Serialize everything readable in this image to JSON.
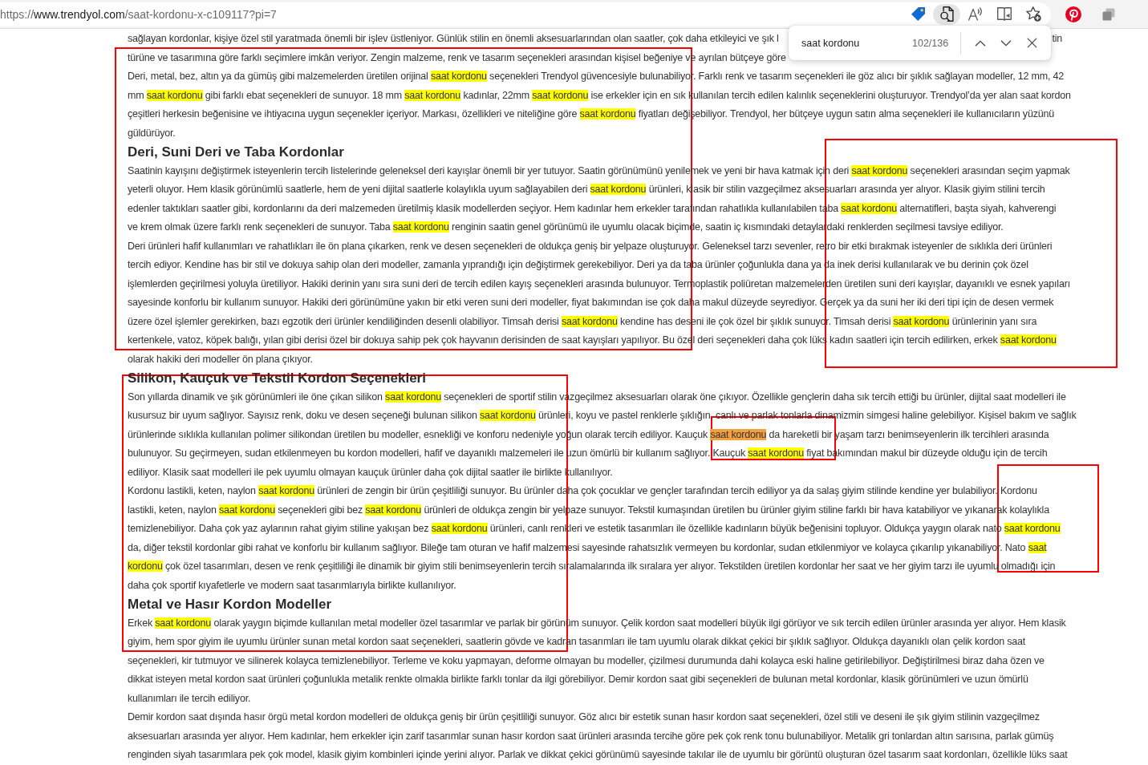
{
  "address_bar": {
    "scheme": "https://",
    "host": "www.trendyol.com",
    "path": "/saat-kordonu-x-c109117?pi=7"
  },
  "toolbar": {
    "find_button_active": true
  },
  "find_bar": {
    "query": "saat kordonu",
    "count": "102/136"
  },
  "article": {
    "sections": [
      {
        "paragraphs": [
          {
            "lines": [
              [
                {
                  "kind": "text",
                  "text": "sağlayan kordonlar, kişiye özel stil yaratmada önemli bir işlev üstleniyor. Günlük stilin en önemli aksesuarlarından olan saatler, çok daha etkileyici ve şık l"
                },
                {
                  "kind": "right-fragment",
                  "text": "tin"
                }
              ],
              [
                {
                  "kind": "text",
                  "text": "türüne ve tasarımına göre farklı seçimlere imkân veriyor. Zengin malzeme, renk ve tasarım seçenekleri arasından kişisel beğeniye ve ayrılan bütçeye göre"
                }
              ]
            ]
          },
          {
            "lines": [
              [
                {
                  "kind": "text",
                  "text": "Deri, metal, bez, altın ya da gümüş gibi malzemelerden üretilen orijinal "
                },
                {
                  "kind": "match",
                  "text": "saat kordonu"
                },
                {
                  "kind": "text",
                  "text": " seçenekleri Trendyol güvencesiyle bulunabiliyor. Farklı renk ve tasarım seçenekleri ile göz alıcı bir şıklık sağlayan modeller, 12 mm, 42"
                }
              ],
              [
                {
                  "kind": "text",
                  "text": "mm "
                },
                {
                  "kind": "match",
                  "text": "saat kordonu"
                },
                {
                  "kind": "text",
                  "text": " gibi farklı ebat seçenekleri de sunuyor. 18 mm "
                },
                {
                  "kind": "match",
                  "text": "saat kordonu"
                },
                {
                  "kind": "text",
                  "text": " kadınlar, 22mm "
                },
                {
                  "kind": "match",
                  "text": "saat kordonu"
                },
                {
                  "kind": "text",
                  "text": " ise erkekler için en sık kullanılan tercih edilen kalınlık seçeneklerini oluşturuyor. Trendyol’da yer alan saat kordon"
                }
              ],
              [
                {
                  "kind": "text",
                  "text": "çeşitleri herkesin beğenisine ve ihtiyacına uygun seçenekler içeriyor. Markası, özellikleri ve niteliğine göre "
                },
                {
                  "kind": "match",
                  "text": "saat kordonu"
                },
                {
                  "kind": "text",
                  "text": " fiyatları değişebiliyor. Trendyol, her bütçeye uygun satın alma seçenekleri ile kullanıcıların yüzünü"
                }
              ],
              [
                {
                  "kind": "text",
                  "text": "güldürüyor."
                }
              ]
            ]
          }
        ]
      },
      {
        "heading": "Deri, Suni Deri ve Taba Kordonlar",
        "paragraphs": [
          {
            "lines": [
              [
                {
                  "kind": "text",
                  "text": "Saatinin kayışını değiştirmek isteyenlerin tercih listelerinde geleneksel deri kayışlar önemli bir yer tutuyor. Saatin görünümünü yenilemek ve yeni bir hava katmak için deri "
                },
                {
                  "kind": "match",
                  "text": "saat kordonu"
                },
                {
                  "kind": "text",
                  "text": " seçenekleri arasından seçim yapmak"
                }
              ],
              [
                {
                  "kind": "text",
                  "text": "yeterli oluyor. Hem klasik görünümlü saatlerle, hem de yeni dijital saatlerle kolaylıkla uyum sağlayabilen deri "
                },
                {
                  "kind": "match",
                  "text": "saat kordonu"
                },
                {
                  "kind": "text",
                  "text": " ürünleri, klasik bir stilin vazgeçilmez aksesuarları arasında yer alıyor. Klasik giyim stilini tercih"
                }
              ],
              [
                {
                  "kind": "text",
                  "text": "edenler taktıkları saatler gibi, kordonlarını da deri malzemeden üretilmiş klasik modellerden seçiyor. Hem kadınlar hem erkekler tarafından rahatlıkla kullanılabilen taba "
                },
                {
                  "kind": "match",
                  "text": "saat kordonu"
                },
                {
                  "kind": "text",
                  "text": " alternatifleri, başta siyah, kahverengi"
                }
              ],
              [
                {
                  "kind": "text",
                  "text": "ve krem olmak üzere farklı renk seçenekleri de sunuyor. Taba "
                },
                {
                  "kind": "match",
                  "text": "saat kordonu"
                },
                {
                  "kind": "text",
                  "text": " renginin saatin genel görünümü ile uyumlu olacak biçimde, saatin iç kısmındaki detaylardaki renklerden seçilmesi tavsiye ediliyor."
                }
              ]
            ]
          },
          {
            "lines": [
              [
                {
                  "kind": "text",
                  "text": "Deri ürünleri hafif kullanımları ve rahatlıkları ile ön plana çıkarken, renk ve desen seçenekleri de oldukça geniş bir yelpaze oluşturuyor. Geleneksel tarzı sevenler, retro bir etki bırakmak isteyenler de sıklıkla deri ürünleri"
                }
              ],
              [
                {
                  "kind": "text",
                  "text": "tercih ediyor. Kendine has bir stil ve dokuya sahip olan deri modeller, zamanla yıprandığı için değiştirmek gerekebiliyor. Deri ya da taba ürünler çoğunlukla dana ya da inek derisi kullanılarak ve bu derinin çok özel"
                }
              ],
              [
                {
                  "kind": "text",
                  "text": "işlemlerden geçirilmesi yoluyla üretiliyor. Hakiki derinin yanı sıra suni deri de tercih edilen kayış seçenekleri arasında bulunuyor. Termoplastik poliüretan malzemelerden üretilen suni deri kayışlar, dayanıklı ve esnek yapıları"
                }
              ],
              [
                {
                  "kind": "text",
                  "text": "sayesinde konforlu bir kullanım sunuyor. Hakiki deri görünümüne yakın bir etki veren suni deri modeller, fiyat bakımından ise çok daha makul düzeyde seyrediyor. Gerçek ya da suni her iki deri tipi için de desen vermek"
                }
              ],
              [
                {
                  "kind": "text",
                  "text": "üzere özel işlemler gerekirken, bazı egzotik deri ürünler kendiliğinden desenli olabiliyor. Timsah derisi "
                },
                {
                  "kind": "match",
                  "text": "saat kordonu"
                },
                {
                  "kind": "text",
                  "text": " kendine has deseni ile çok özel bir şıklık sunuyor. Timsah derisi "
                },
                {
                  "kind": "match",
                  "text": "saat kordonu"
                },
                {
                  "kind": "text",
                  "text": " ürünlerinin yanı sıra"
                }
              ],
              [
                {
                  "kind": "text",
                  "text": "kertenkele, vatoz, köpek balığı, yılan gibi derisi özel bir dokuya sahip pek çok hayvanın derisinden de saat kayışları yapılıyor. Bu özel deri seçenekleri daha çok lüks kadın saatleri için tercih edilirken, erkek "
                },
                {
                  "kind": "match",
                  "text": "saat kordonu"
                }
              ],
              [
                {
                  "kind": "text",
                  "text": "olarak hakiki deri modeller ön plana çıkıyor."
                }
              ]
            ]
          }
        ]
      },
      {
        "heading": "Silikon, Kauçuk ve Tekstil Kordon Seçenekleri",
        "paragraphs": [
          {
            "lines": [
              [
                {
                  "kind": "text",
                  "text": "Son yıllarda dinamik ve şık görünümleri ile öne çıkan silikon "
                },
                {
                  "kind": "match",
                  "text": "saat kordonu"
                },
                {
                  "kind": "text",
                  "text": " seçenekleri de sportif stilin vazgeçilmez aksesuarları olarak öne çıkıyor. Özellikle gençlerin daha sık tercih ettiği bu ürünler, dijital saat modelleri ile"
                }
              ],
              [
                {
                  "kind": "text",
                  "text": "kusursuz bir uyum sağlıyor. Sayısız renk, doku ve desen seçeneği bulunan silikon "
                },
                {
                  "kind": "match",
                  "text": "saat kordonu"
                },
                {
                  "kind": "text",
                  "text": " ürünleri, koyu ve pastel renklerle şıklığın, canlı ve parlak tonlarla dinamizmin simgesi haline gelebiliyor. Kişisel bakım ve sağlık"
                }
              ],
              [
                {
                  "kind": "text",
                  "text": "ürünlerinde sıklıkla kullanılan polimer silikondan üretilen bu modeller, esnekliği ve konforu nedeniyle yoğun olarak tercih ediliyor. Kauçuk "
                },
                {
                  "kind": "current-match",
                  "text": "saat kordonu"
                },
                {
                  "kind": "text",
                  "text": " da hareketli bir yaşam tarzı benimseyenlerin ilk tercihleri arasında"
                }
              ],
              [
                {
                  "kind": "text",
                  "text": "bulunuyor. Su geçirmeyen, sudan etkilenmeyen bu kordon modelleri, hafif ve dayanıklı malzemeleri ile uzun ömürlü bir kullanım sağlıyor. Kauçuk "
                },
                {
                  "kind": "match",
                  "text": "saat kordonu"
                },
                {
                  "kind": "text",
                  "text": " fiyat bakımından makul bir düzeyde olduğu için de tercih"
                }
              ],
              [
                {
                  "kind": "text",
                  "text": "ediliyor. Klasik saat modelleri ile pek uyumlu olmayan kauçuk ürünler daha çok dijital saatler ile birlikte kullanılıyor."
                }
              ]
            ]
          },
          {
            "lines": [
              [
                {
                  "kind": "text",
                  "text": "Kordonu lastikli, keten, naylon "
                },
                {
                  "kind": "match",
                  "text": "saat kordonu"
                },
                {
                  "kind": "text",
                  "text": " ürünleri de zengin bir ürün çeşitliliği sunuyor. Bu ürünler daha çok çocuklar ve gençler tarafından tercih ediliyor ya da salaş giyim stilinde kendine yer bulabiliyor. Kordonu"
                }
              ],
              [
                {
                  "kind": "text",
                  "text": "lastikli, keten, naylon "
                },
                {
                  "kind": "match",
                  "text": "saat kordonu"
                },
                {
                  "kind": "text",
                  "text": " seçenekleri gibi bez "
                },
                {
                  "kind": "match",
                  "text": "saat kordonu"
                },
                {
                  "kind": "text",
                  "text": " ürünleri de oldukça zengin bir yelpaze sunuyor. Tekstil kumaşından üretilen bu ürünler giyim stiline farklı bir hava katabiliyor ve yıkanarak kolaylıkla"
                }
              ],
              [
                {
                  "kind": "text",
                  "text": "temizlenebiliyor. Daha çok yaz aylarının rahat giyim stiline yakışan bez "
                },
                {
                  "kind": "match",
                  "text": "saat kordonu"
                },
                {
                  "kind": "text",
                  "text": " ürünleri, canlı renkleri ve estetik tasarımları ile özellikle kadınların büyük beğenisini topluyor. Oldukça yaygın olarak nato "
                },
                {
                  "kind": "match",
                  "text": "saat kordonu"
                }
              ],
              [
                {
                  "kind": "text",
                  "text": "da, diğer tekstil kordonlar gibi rahat ve konforlu bir kullanım sağlıyor. Bileğe tam oturan ve hafif malzemesi sayesinde rahatsızlık vermeyen bu kordonlar, sudan etkilenmiyor ve kolayca çıkarılıp yıkanabiliyor. Nato "
                },
                {
                  "kind": "match",
                  "text": "saat"
                }
              ],
              [
                {
                  "kind": "match",
                  "text": "kordonu"
                },
                {
                  "kind": "text",
                  "text": " çok özel tasarımları, desen ve renk çeşitliliği ile dinamik bir giyim stili benimseyenlerin tercih sıralamalarında ilk sıralara yer alıyor. Tekstilden üretilen kordonlar her saat ve her giyim tarzı ile uyumlu olmadığı için"
                }
              ],
              [
                {
                  "kind": "text",
                  "text": "daha çok sportif kıyafetlerle ve modern saat tasarımlarıyla birlikte kullanılıyor."
                }
              ]
            ]
          }
        ]
      },
      {
        "heading": "Metal ve Hasır Kordon Modeller",
        "paragraphs": [
          {
            "lines": [
              [
                {
                  "kind": "text",
                  "text": "Erkek "
                },
                {
                  "kind": "match",
                  "text": "saat kordonu"
                },
                {
                  "kind": "text",
                  "text": " olarak yaygın biçimde kullanılan metal modeller özel tasarımlar ve parlak bir görünüm sunuyor. Çelik kordon saat modelleri büyük ilgi görüyor ve sık tercih edilen ürünler arasında yer alıyor. Hem klasik"
                }
              ],
              [
                {
                  "kind": "text",
                  "text": "giyim, hem spor giyim ile uyumlu ürünler sunan metal kordon saat seçenekleri, saatlerin gövde ve kadran tasarımları ile tam uyumlu olarak dikkat çekici bir şıklık sağlıyor. Oldukça dayanıklı olan çelik kordon saat"
                }
              ],
              [
                {
                  "kind": "text",
                  "text": "seçenekleri, kir tutmuyor ve silinerek kolayca temizlenebiliyor. Terleme ve koku yapmayan, deforme olmayan bu modeller, çizilmesi durumunda dahi kolayca eski haline getirilebiliyor. Değiştirilmesi biraz daha özen ve"
                }
              ],
              [
                {
                  "kind": "text",
                  "text": "dikkat isteyen metal kordon saat ürünleri çoğunlukla metalik renkte olmakla birlikte farklı tonlar da ilgi görebiliyor. Demir kordon saat gibi seçenekleri de bulunan metal kordonlar, klasik görünümleri ve uzun ömürlü"
                }
              ],
              [
                {
                  "kind": "text",
                  "text": "kullanımları ile tercih ediliyor."
                }
              ]
            ]
          },
          {
            "lines": [
              [
                {
                  "kind": "text",
                  "text": "Demir kordon saat dışında hasır örgü metal kordon modelleri de oldukça geniş bir ürün çeşitliliği sunuyor. Göz alıcı bir estetik sunan hasır kordon saat seçenekleri, özel stili ve deseni ile şık giyim stilinin vazgeçilmez"
                }
              ],
              [
                {
                  "kind": "text",
                  "text": "aksesuarları arasında yer alıyor. Hem kadınlar, hem erkekler için zarif tasarımlar sunan hasır kordon saat ürünleri arasında tercihe göre pek çok renk tonu bulunabiliyor. Metalik gri tonlardan altın sarısına, parlak gümüş"
                }
              ],
              [
                {
                  "kind": "text",
                  "text": "renginden siyah tasarımlara pek çok model, klasik giyim kombinleri içinde yerini alıyor. Parlak ve dikkat çekici görünümü sayesinde takılar ile de uyumlu bir görüntü oluşturan özel tasarım saat kordonları, özellikle lüks saat"
                }
              ]
            ]
          }
        ]
      }
    ]
  },
  "annotation_boxes": [
    {
      "kind": "rectangle"
    },
    {
      "kind": "rectangle"
    },
    {
      "kind": "rectangle"
    },
    {
      "kind": "rectangle"
    },
    {
      "kind": "rectangle"
    }
  ]
}
